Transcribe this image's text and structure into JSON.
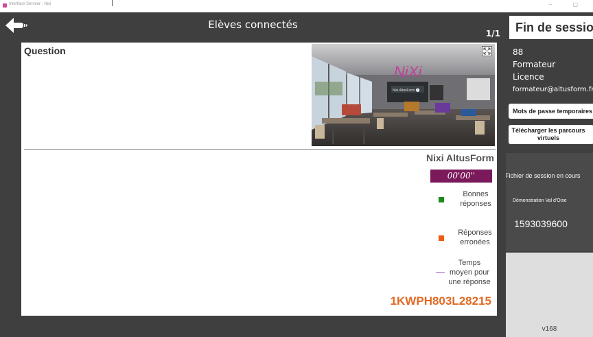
{
  "window": {
    "title": "Interface Serveur - Nixi",
    "controls": "– ▢"
  },
  "header": {
    "title": "Elèves connectés",
    "page_counter": "1/1"
  },
  "question": {
    "label": "Question"
  },
  "thumbnail": {
    "logo_text": "NiXi",
    "tablet_text": "Nixi AltusForm 🕐"
  },
  "stats": {
    "title": "Nixi AltusForm",
    "timer": "00'00''",
    "legend": {
      "good": "Bonnes réponses",
      "bad": "Réponses erronées",
      "time": "Temps moyen pour une réponse"
    },
    "code": "1KWPH803L28215"
  },
  "sidebar": {
    "end_session": "Fin de session",
    "user_id": "88",
    "role": "Formateur",
    "license": "Licence",
    "email": "formateur@altusform.fr",
    "btn_passwords": "Mots de passe temporaires",
    "btn_download": "Télécharger les parcours virtuels",
    "session_file": "Fichier de session en cours",
    "session_name": "Démonstration Val d'Oise",
    "session_number": "1593039600",
    "version": "v168"
  },
  "colors": {
    "background": "#3f3f3f",
    "timer": "#7b1a5b",
    "good": "#1e8a1e",
    "bad": "#f05a10",
    "avg_time": "#c9a6dd",
    "code": "#e06a24"
  },
  "icons": {
    "back": "arrow-left-icon",
    "expand": "expand-icon"
  }
}
